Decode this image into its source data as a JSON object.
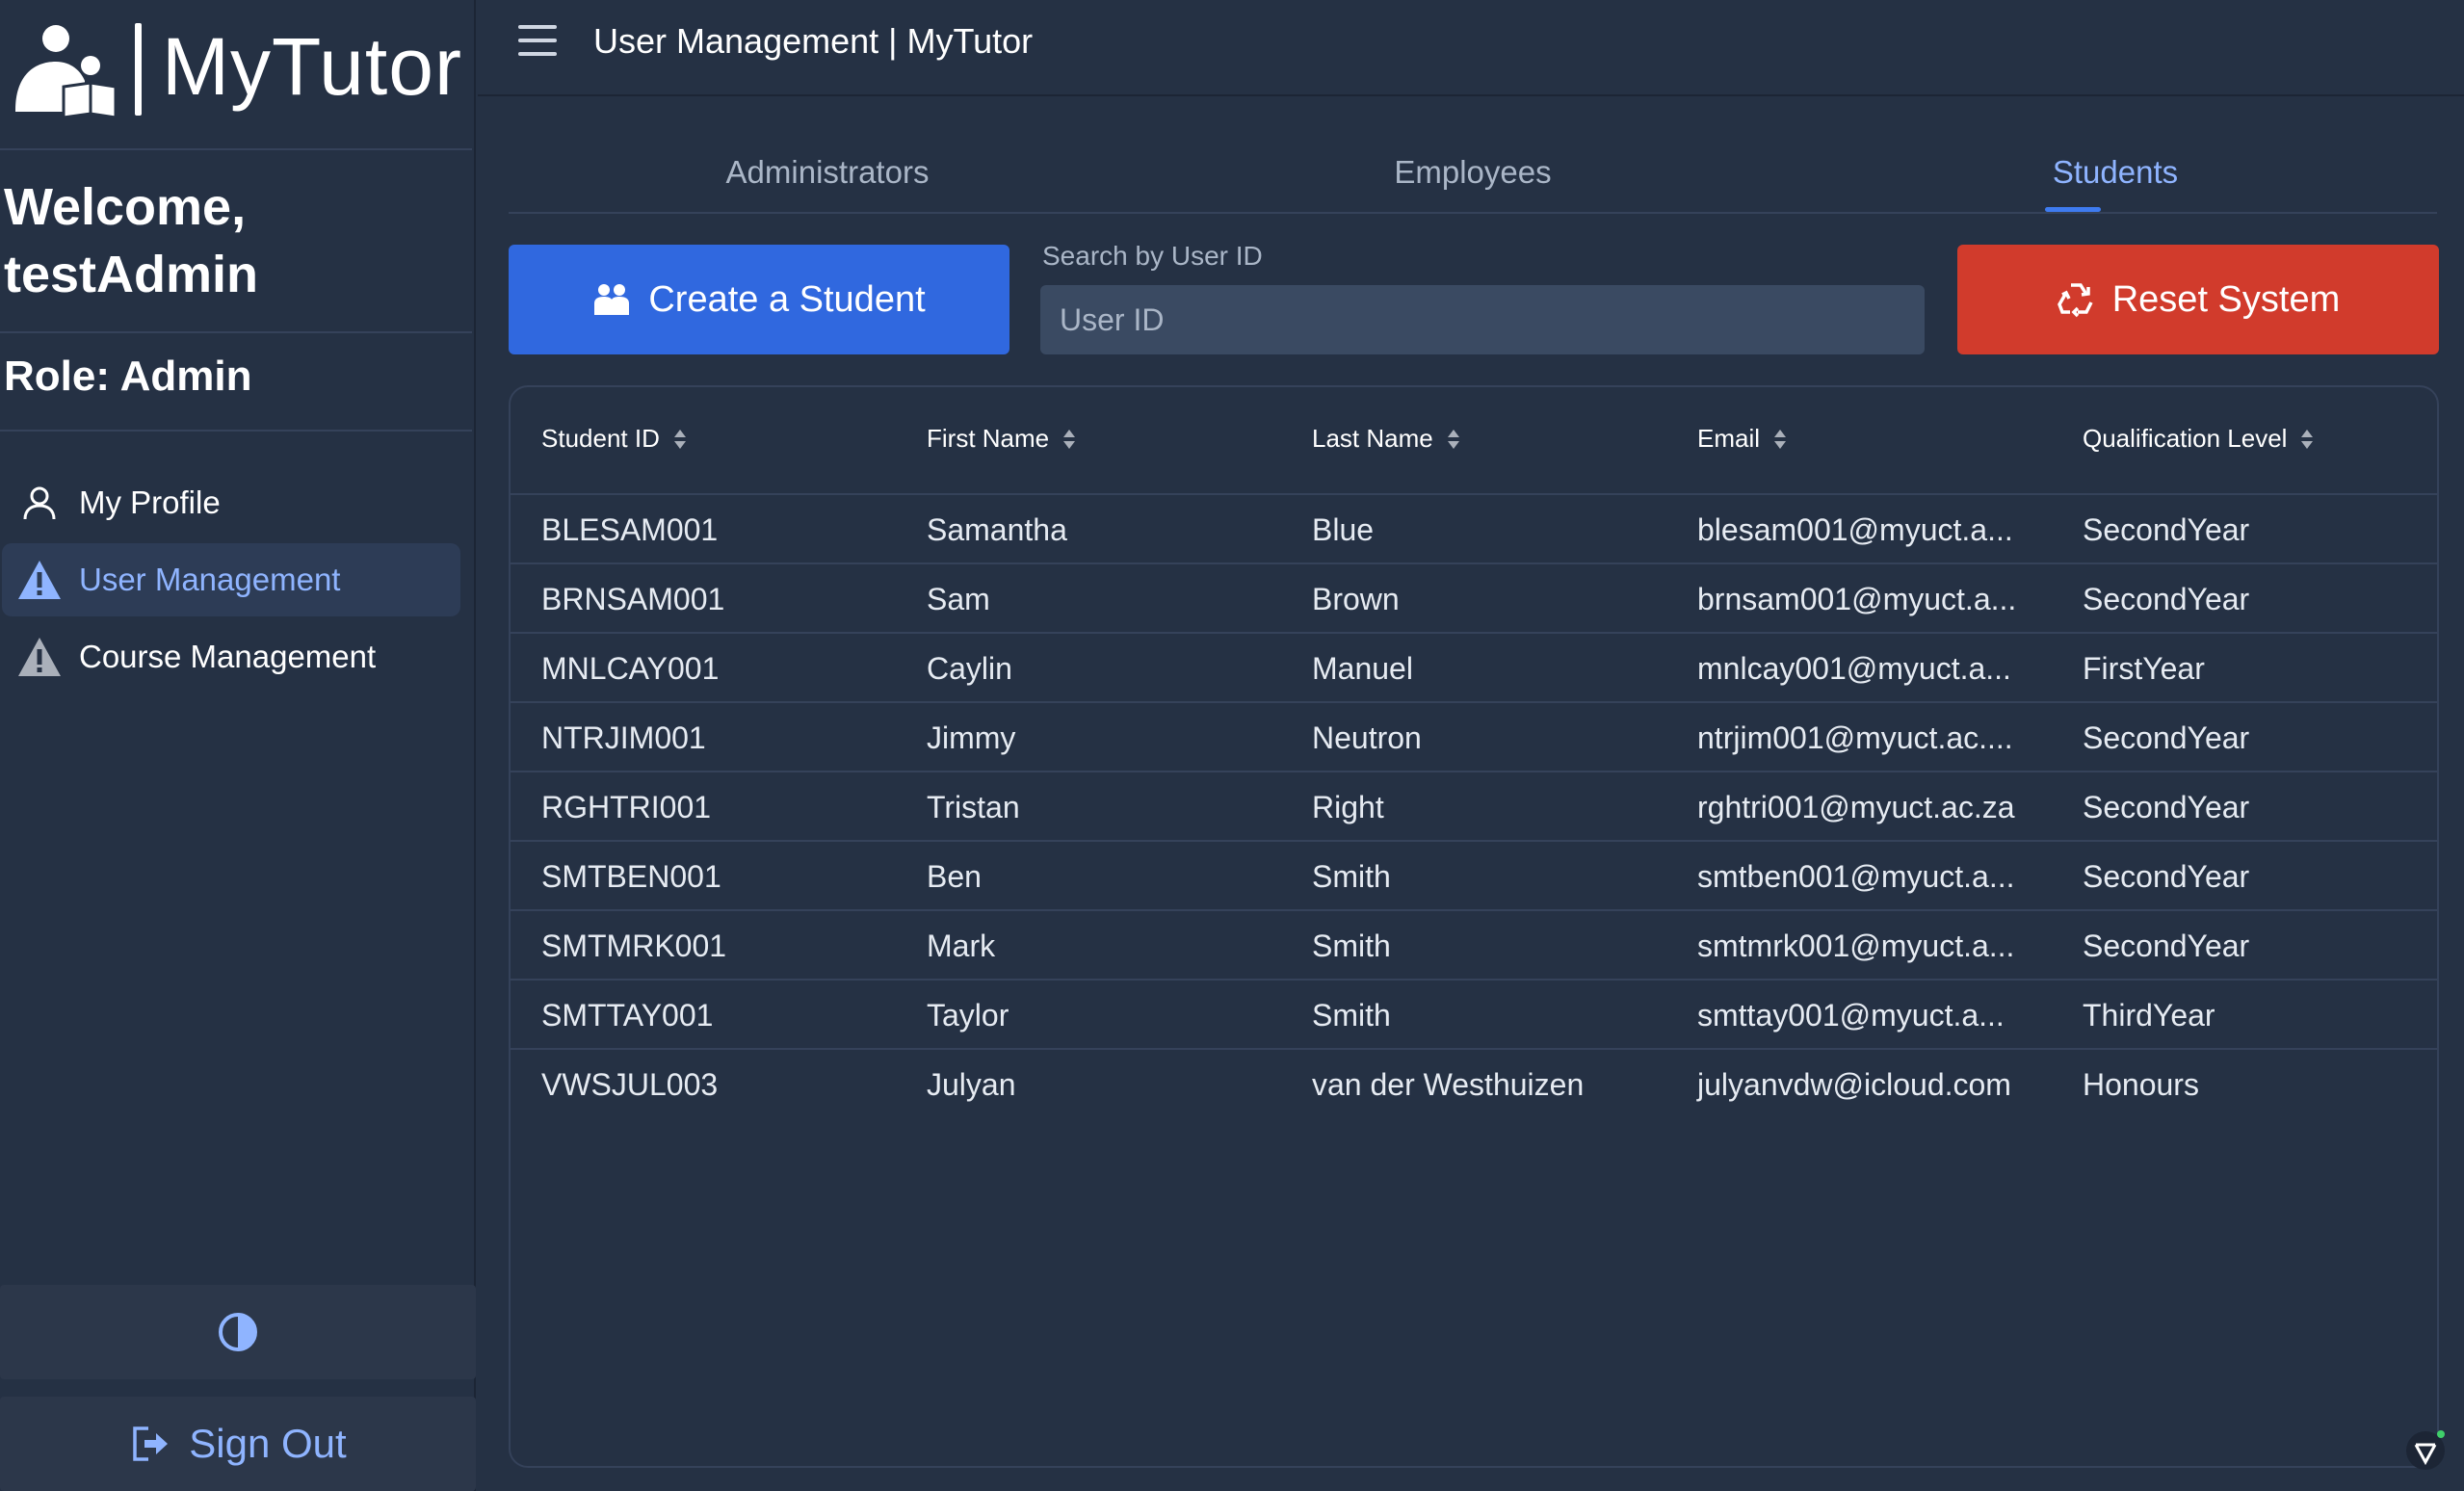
{
  "brand": {
    "name": "MyTutor"
  },
  "sidebar": {
    "welcome_line1": "Welcome,",
    "welcome_line2": "testAdmin",
    "role": "Role: Admin",
    "items": [
      {
        "label": "My Profile",
        "icon": "user-icon",
        "active": false
      },
      {
        "label": "User Management",
        "icon": "warning-icon",
        "active": true
      },
      {
        "label": "Course Management",
        "icon": "warning-icon",
        "active": false
      }
    ],
    "theme_toggle_icon": "contrast-icon",
    "signout_label": "Sign Out"
  },
  "header": {
    "title": "User Management | MyTutor"
  },
  "tabs": [
    {
      "label": "Administrators",
      "active": false
    },
    {
      "label": "Employees",
      "active": false
    },
    {
      "label": "Students",
      "active": true
    }
  ],
  "toolbar": {
    "create_label": "Create a Student",
    "search_label": "Search by User ID",
    "search_placeholder": "User ID",
    "reset_label": "Reset System"
  },
  "table": {
    "columns": [
      "Student ID",
      "First Name",
      "Last Name",
      "Email",
      "Qualification Level"
    ],
    "rows": [
      [
        "BLESAM001",
        "Samantha",
        "Blue",
        "blesam001@myuct.a...",
        "SecondYear"
      ],
      [
        "BRNSAM001",
        "Sam",
        "Brown",
        "brnsam001@myuct.a...",
        "SecondYear"
      ],
      [
        "MNLCAY001",
        "Caylin",
        "Manuel",
        "mnlcay001@myuct.a...",
        "FirstYear"
      ],
      [
        "NTRJIM001",
        "Jimmy",
        "Neutron",
        "ntrjim001@myuct.ac....",
        "SecondYear"
      ],
      [
        "RGHTRI001",
        "Tristan",
        "Right",
        "rghtri001@myuct.ac.za",
        "SecondYear"
      ],
      [
        "SMTBEN001",
        "Ben",
        "Smith",
        "smtben001@myuct.a...",
        "SecondYear"
      ],
      [
        "SMTMRK001",
        "Mark",
        "Smith",
        "smtmrk001@myuct.a...",
        "SecondYear"
      ],
      [
        "SMTTAY001",
        "Taylor",
        "Smith",
        "smttay001@myuct.a...",
        "ThirdYear"
      ],
      [
        "VWSJUL003",
        "Julyan",
        "van der Westhuizen",
        "julyanvdw@icloud.com",
        "Honours"
      ]
    ]
  },
  "colors": {
    "background": "#253144",
    "primary": "#3068df",
    "danger": "#d13b2c",
    "accent_text": "#8fb4ff"
  }
}
